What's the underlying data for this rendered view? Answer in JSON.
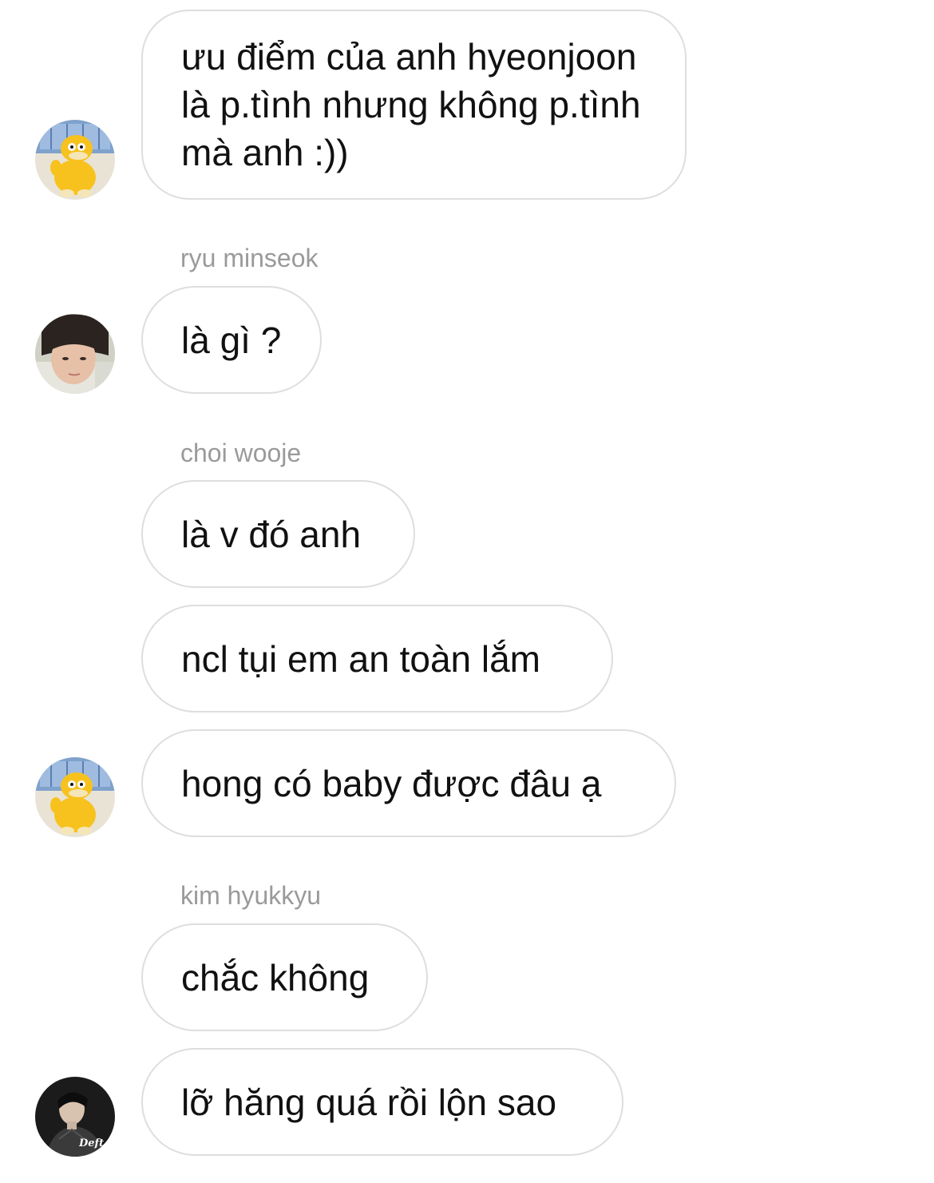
{
  "messages": [
    {
      "text": "ưu điểm của anh hyeonjoon là p.tình nhưng không p.tình mà anh :))"
    },
    {
      "sender": "ryu minseok",
      "text": "là gì ?"
    },
    {
      "sender": "choi wooje",
      "text": "là v đó anh"
    },
    {
      "text": "ncl tụi em an toàn lắm"
    },
    {
      "text": "hong có baby được đâu ạ"
    },
    {
      "sender": "kim hyukkyu",
      "text": "chắc không"
    },
    {
      "text": "lỡ hăng quá rồi lộn sao"
    }
  ],
  "avatars": {
    "duck": {
      "icon": "psyduck-avatar-icon"
    },
    "minseok": {
      "icon": "person-avatar-icon"
    },
    "hyukkyu": {
      "icon": "person-dark-avatar-icon",
      "watermark": "Deft"
    }
  },
  "colors": {
    "bubble_border": "#dedede",
    "sender_text": "#9a9a9a",
    "message_text": "#111111"
  }
}
